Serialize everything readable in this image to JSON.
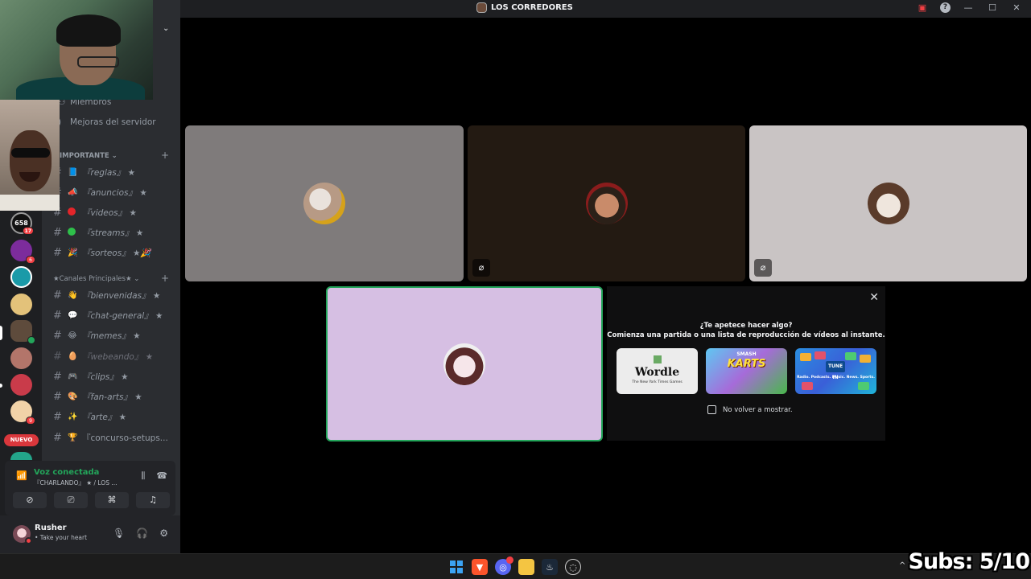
{
  "window": {
    "title": "LOS CORREDORES"
  },
  "rail": {
    "badges": [
      "17",
      "6",
      "6",
      "9"
    ],
    "new_label": "NUEVO"
  },
  "sidebar": {
    "items": [
      {
        "label": "Miembros"
      },
      {
        "label": "Mejoras del servidor"
      }
    ],
    "category1": "IMPORTANTE",
    "category2": "★Canales Principales★",
    "channels": [
      {
        "name": "『reglas』 ★",
        "emoji": "📘",
        "dim": false
      },
      {
        "name": "『anuncios』 ★",
        "emoji": "📣",
        "dim": false
      },
      {
        "name": "『videos』 ★",
        "emoji": "red-dot",
        "dim": false
      },
      {
        "name": "『streams』 ★",
        "emoji": "green-dot",
        "dim": false
      },
      {
        "name": "『sorteos』 ★🎉",
        "emoji": "🎉",
        "dim": false
      },
      {
        "name": "『bienvenidas』 ★",
        "emoji": "👋",
        "dim": false
      },
      {
        "name": "『chat-general』 ★",
        "emoji": "💬",
        "dim": false
      },
      {
        "name": "『memes』 ★",
        "emoji": "😂",
        "dim": false
      },
      {
        "name": "『webeando』 ★",
        "emoji": "🥚",
        "dim": true
      },
      {
        "name": "『clips』 ★",
        "emoji": "🎮",
        "dim": false
      },
      {
        "name": "『fan-arts』 ★",
        "emoji": "🎨",
        "dim": false
      },
      {
        "name": "『arte』 ★",
        "emoji": "✨",
        "dim": false
      },
      {
        "name": "『concurso-setups...",
        "emoji": "🏆",
        "dim": false
      }
    ]
  },
  "voice": {
    "status": "Voz conectada",
    "channel": "『CHARLANDO』 ★ / LOS ..."
  },
  "user": {
    "name": "Rusher",
    "activity": "• Take your heart"
  },
  "activity_panel": {
    "heading": "¿Te apetece hacer algo?",
    "subheading": "Comienza una partida o una lista de reproducción de vídeos al instante.",
    "cards": [
      {
        "title": "Wordle",
        "subtitle": "The New York Times Games"
      },
      {
        "title": "KARTS",
        "subtitle": "SMASH"
      },
      {
        "title": "TUNE IN",
        "subtitle": "Radio. Podcasts. Music. News. Sports."
      }
    ],
    "checkbox_label": "No volver a mostrar."
  },
  "overlay": {
    "subs_text": "Subs: 5/10"
  },
  "colors": {
    "accent_green": "#23a55a",
    "danger_red": "#f23f43",
    "tile1_bg": "#7f7b7b",
    "tile2_bg": "#231a12",
    "tile3_bg": "#c9c4c4",
    "tile4_bg": "#d6bfe3"
  }
}
